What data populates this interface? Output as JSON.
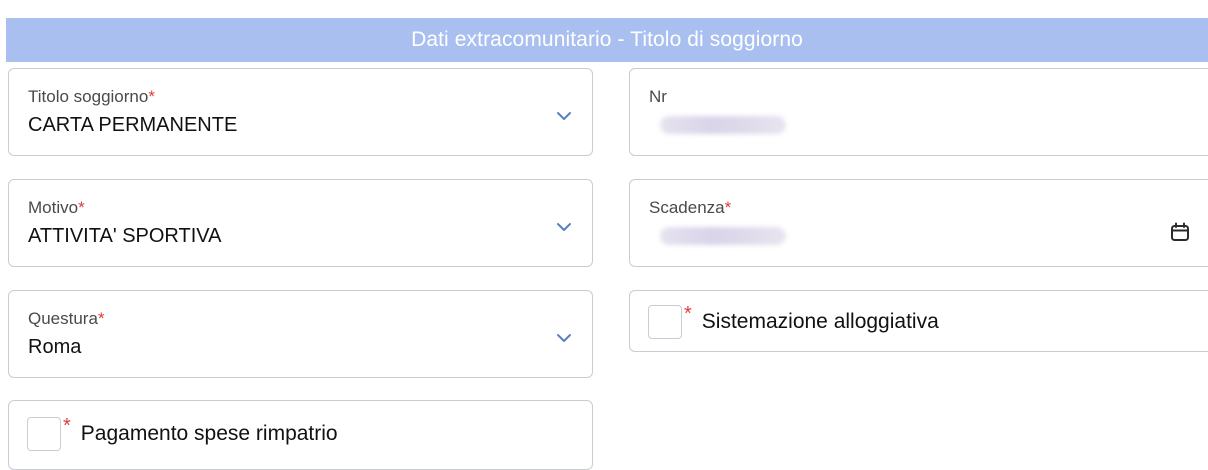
{
  "header": {
    "title": "Dati extracomunitario - Titolo di soggiorno"
  },
  "required_mark": "*",
  "fields": {
    "titolo": {
      "label": "Titolo soggiorno",
      "value": "CARTA PERMANENTE"
    },
    "nr": {
      "label": "Nr",
      "value_state": "blurred"
    },
    "motivo": {
      "label": "Motivo",
      "value": "ATTIVITA' SPORTIVA"
    },
    "scadenza": {
      "label": "Scadenza",
      "value_state": "blurred"
    },
    "questura": {
      "label": "Questura",
      "value": "Roma"
    }
  },
  "checkboxes": {
    "sistemazione": {
      "label": "Sistemazione alloggiativa",
      "checked": false
    },
    "pagamento": {
      "label": "Pagamento spese rimpatrio",
      "checked": false
    }
  },
  "icons": {
    "dropdown": "chevron-down-icon",
    "date": "calendar-icon"
  },
  "colors": {
    "header_bg": "#a9bff0",
    "required": "#e23b3b",
    "chevron": "#5a7fc4"
  }
}
